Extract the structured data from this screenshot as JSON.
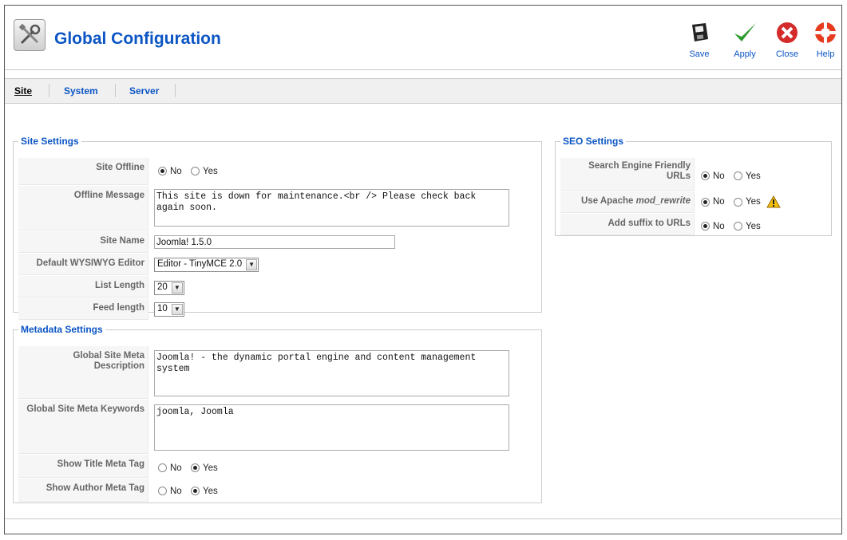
{
  "header": {
    "title": "Global Configuration",
    "toolbar": {
      "save_label": "Save",
      "apply_label": "Apply",
      "close_label": "Close",
      "help_label": "Help"
    }
  },
  "tabs": [
    {
      "label": "Site",
      "active": true
    },
    {
      "label": "System",
      "active": false
    },
    {
      "label": "Server",
      "active": false
    }
  ],
  "site_settings": {
    "legend": "Site Settings",
    "site_offline": {
      "label": "Site Offline",
      "options": [
        "No",
        "Yes"
      ],
      "selected": "No"
    },
    "offline_message": {
      "label": "Offline Message",
      "value": "This site is down for maintenance.<br /> Please check back again soon."
    },
    "site_name": {
      "label": "Site Name",
      "value": "Joomla! 1.5.0"
    },
    "default_editor": {
      "label": "Default WYSIWYG Editor",
      "value": "Editor - TinyMCE 2.0"
    },
    "list_length": {
      "label": "List Length",
      "value": "20"
    },
    "feed_length": {
      "label": "Feed length",
      "value": "10"
    }
  },
  "metadata_settings": {
    "legend": "Metadata Settings",
    "meta_description": {
      "label": "Global Site Meta Description",
      "value": "Joomla! - the dynamic portal engine and content management system"
    },
    "meta_keywords": {
      "label": "Global Site Meta Keywords",
      "value": "joomla, Joomla"
    },
    "show_title_meta": {
      "label": "Show Title Meta Tag",
      "options": [
        "No",
        "Yes"
      ],
      "selected": "Yes"
    },
    "show_author_meta": {
      "label": "Show Author Meta Tag",
      "options": [
        "No",
        "Yes"
      ],
      "selected": "Yes"
    }
  },
  "seo_settings": {
    "legend": "SEO Settings",
    "sef_urls": {
      "label": "Search Engine Friendly URLs",
      "options": [
        "No",
        "Yes"
      ],
      "selected": "No"
    },
    "mod_rewrite": {
      "label_prefix": "Use Apache ",
      "label_em": "mod_rewrite",
      "options": [
        "No",
        "Yes"
      ],
      "selected": "No"
    },
    "suffix": {
      "label": "Add suffix to URLs",
      "options": [
        "No",
        "Yes"
      ],
      "selected": "No"
    }
  },
  "colors": {
    "link_blue": "#0b55c4",
    "apply_green": "#2e9b2e",
    "close_red": "#d42a2a",
    "warning_yellow": "#f4c20d"
  },
  "icons": [
    "config-tools-icon",
    "save-icon",
    "apply-check-icon",
    "close-x-icon",
    "help-lifebuoy-icon",
    "warning-icon"
  ]
}
